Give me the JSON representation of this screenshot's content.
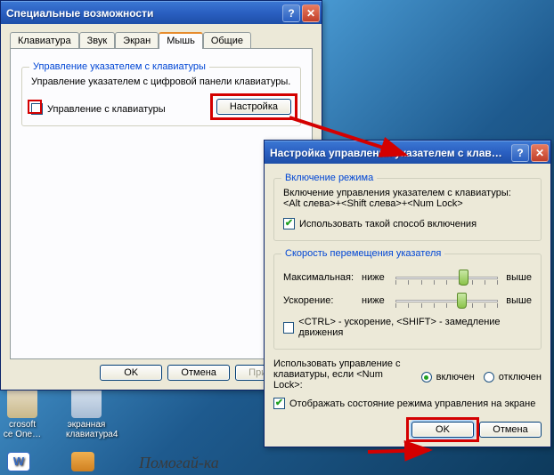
{
  "win1": {
    "title": "Специальные возможности",
    "tabs": [
      "Клавиатура",
      "Звук",
      "Экран",
      "Мышь",
      "Общие"
    ],
    "active_tab_index": 3,
    "group_legend": "Управление указателем с клавиатуры",
    "group_desc": "Управление указателем с цифровой панели клавиатуры.",
    "check_label": "Управление с клавиатуры",
    "settings_btn": "Настройка",
    "ok": "OK",
    "apply": "Применить",
    "cancel": "Отмена"
  },
  "win2": {
    "title": "Настройка управления указателем с клав…",
    "group1_legend": "Включение режима",
    "group1_desc_a": "Включение управления указателем с клавиатуры:",
    "group1_desc_b": "<Alt слева>+<Shift слева>+<Num Lock>",
    "group1_check": "Использовать такой способ включения",
    "group2_legend": "Скорость перемещения указателя",
    "slider1_label": "Максимальная:",
    "slider2_label": "Ускорение:",
    "mark_low": "ниже",
    "mark_high": "выше",
    "ctrlshift": "<CTRL> - ускорение, <SHIFT> - замедление движения",
    "numlock_a": "Использовать управление с",
    "numlock_b": "клавиатуры, если <Num Lock>:",
    "radio_on": "включен",
    "radio_off": "отключен",
    "show_state": "Отображать состояние режима управления на экране",
    "ok": "OK",
    "cancel": "Отмена"
  },
  "desktop": {
    "icon1": "crosoft\nce One…",
    "icon2": "экранная\nклавиатура4",
    "watermark": "Помогай-ка"
  }
}
